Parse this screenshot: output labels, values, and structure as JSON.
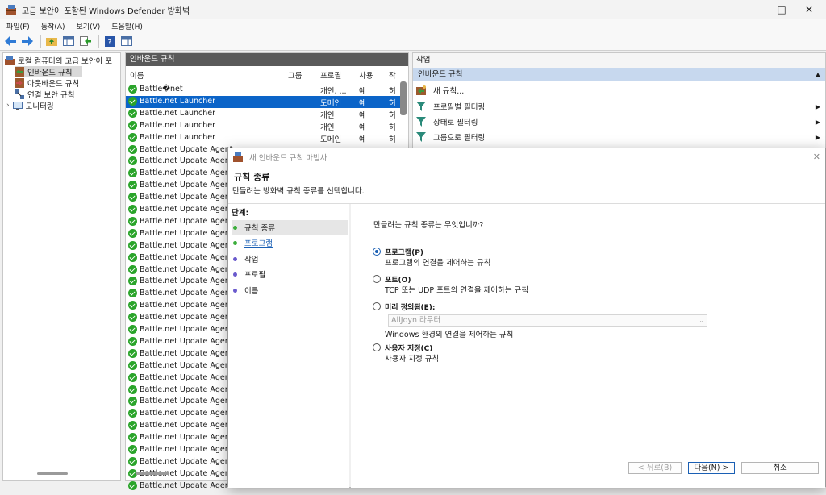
{
  "window": {
    "title": "고급 보안이 포함된 Windows Defender 방화벽"
  },
  "menu": [
    "파일(F)",
    "동작(A)",
    "보기(V)",
    "도움말(H)"
  ],
  "tree": {
    "root": "로컬 컴퓨터의 고급 보안이 포",
    "items": [
      "인바운드 규칙",
      "아웃바운드 규칙",
      "연결 보안 규칙",
      "모니터링"
    ]
  },
  "list": {
    "header": "인바운드 규칙",
    "columns": {
      "name": "이름",
      "group": "그룹",
      "profile": "프로필",
      "enabled": "사용",
      "action": "작"
    },
    "rows": [
      {
        "name": "Battle�net",
        "profile": "개인, ...",
        "enabled": "예",
        "action": "허"
      },
      {
        "name": "Battle.net Launcher",
        "profile": "도메인",
        "enabled": "예",
        "action": "허"
      },
      {
        "name": "Battle.net Launcher",
        "profile": "개인",
        "enabled": "예",
        "action": "허"
      },
      {
        "name": "Battle.net Launcher",
        "profile": "개인",
        "enabled": "예",
        "action": "허"
      },
      {
        "name": "Battle.net Launcher",
        "profile": "도메인",
        "enabled": "예",
        "action": "허"
      },
      {
        "name": "Battle.net Update Agent",
        "profile": "",
        "enabled": "",
        "action": ""
      },
      {
        "name": "Battle.net Update Agent",
        "profile": "",
        "enabled": "",
        "action": ""
      },
      {
        "name": "Battle.net Update Agent",
        "profile": "",
        "enabled": "",
        "action": ""
      },
      {
        "name": "Battle.net Update Agent",
        "profile": "",
        "enabled": "",
        "action": ""
      },
      {
        "name": "Battle.net Update Agent",
        "profile": "",
        "enabled": "",
        "action": ""
      },
      {
        "name": "Battle.net Update Agent",
        "profile": "",
        "enabled": "",
        "action": ""
      },
      {
        "name": "Battle.net Update Agent",
        "profile": "",
        "enabled": "",
        "action": ""
      },
      {
        "name": "Battle.net Update Agent",
        "profile": "",
        "enabled": "",
        "action": ""
      },
      {
        "name": "Battle.net Update Agent",
        "profile": "",
        "enabled": "",
        "action": ""
      },
      {
        "name": "Battle.net Update Agent",
        "profile": "",
        "enabled": "",
        "action": ""
      },
      {
        "name": "Battle.net Update Agent",
        "profile": "",
        "enabled": "",
        "action": ""
      },
      {
        "name": "Battle.net Update Agent",
        "profile": "",
        "enabled": "",
        "action": ""
      },
      {
        "name": "Battle.net Update Agent",
        "profile": "",
        "enabled": "",
        "action": ""
      },
      {
        "name": "Battle.net Update Agent",
        "profile": "",
        "enabled": "",
        "action": ""
      },
      {
        "name": "Battle.net Update Agent",
        "profile": "",
        "enabled": "",
        "action": ""
      },
      {
        "name": "Battle.net Update Agent",
        "profile": "",
        "enabled": "",
        "action": ""
      },
      {
        "name": "Battle.net Update Agent",
        "profile": "",
        "enabled": "",
        "action": ""
      },
      {
        "name": "Battle.net Update Agent",
        "profile": "",
        "enabled": "",
        "action": ""
      },
      {
        "name": "Battle.net Update Agent",
        "profile": "",
        "enabled": "",
        "action": ""
      },
      {
        "name": "Battle.net Update Agent",
        "profile": "",
        "enabled": "",
        "action": ""
      },
      {
        "name": "Battle.net Update Agent",
        "profile": "",
        "enabled": "",
        "action": ""
      },
      {
        "name": "Battle.net Update Agent",
        "profile": "",
        "enabled": "",
        "action": ""
      },
      {
        "name": "Battle.net Update Agent",
        "profile": "",
        "enabled": "",
        "action": ""
      },
      {
        "name": "Battle.net Update Agent",
        "profile": "",
        "enabled": "",
        "action": ""
      },
      {
        "name": "Battle.net Update Agent",
        "profile": "",
        "enabled": "",
        "action": ""
      },
      {
        "name": "Battle.net Update Agent",
        "profile": "",
        "enabled": "",
        "action": ""
      },
      {
        "name": "Battle.net Update Agent",
        "profile": "",
        "enabled": "",
        "action": ""
      },
      {
        "name": "Battle.net Update Agent",
        "profile": "",
        "enabled": "",
        "action": ""
      },
      {
        "name": "Battle.net Update Agent",
        "profile": "",
        "enabled": "",
        "action": ""
      }
    ],
    "selected_index": 1
  },
  "actions": {
    "header": "작업",
    "section": "인바운드 규칙",
    "items": [
      "새 규칙...",
      "프로필별 필터링",
      "상태로 필터링",
      "그룹으로 필터링"
    ]
  },
  "wizard": {
    "title": "새 인바운드 규칙 마법사",
    "heading": "규칙 종류",
    "subheading": "만들려는 방화벽 규칙 종류를 선택합니다.",
    "steps_title": "단계:",
    "steps": [
      "규칙 종류",
      "프로그램",
      "작업",
      "프로필",
      "이름"
    ],
    "question": "만들려는 규칙 종류는 무엇입니까?",
    "options": [
      {
        "label": "프로그램(P)",
        "desc": "프로그램의 연결을 제어하는 규칙",
        "selected": true
      },
      {
        "label": "포트(O)",
        "desc": "TCP 또는 UDP 포트의 연결을 제어하는 규칙",
        "selected": false
      },
      {
        "label": "미리 정의됨(E):",
        "desc": "Windows 환경의 연결을 제어하는 규칙",
        "selected": false
      },
      {
        "label": "사용자 지정(C)",
        "desc": "사용자 지정 규칙",
        "selected": false
      }
    ],
    "preset_value": "AllJoyn 라우터",
    "buttons": {
      "back": "< 뒤로(B)",
      "next": "다음(N) >",
      "cancel": "취소"
    }
  }
}
